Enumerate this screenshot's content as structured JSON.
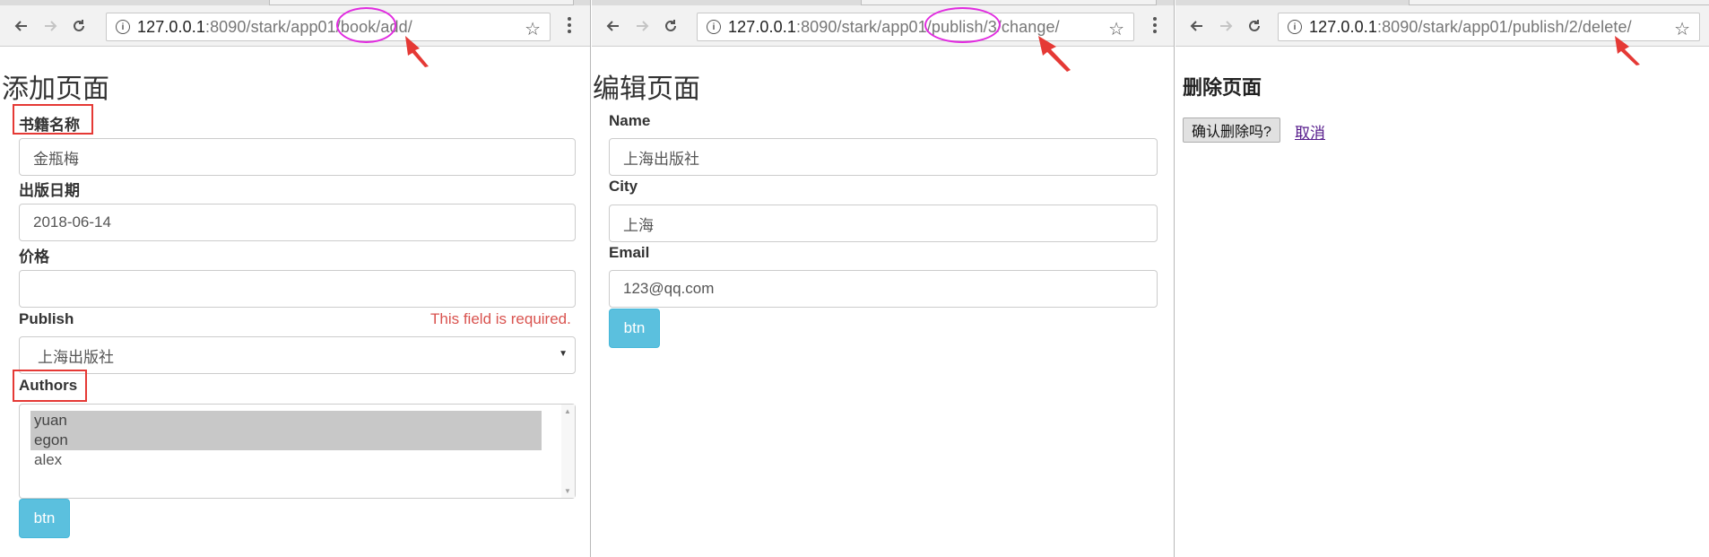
{
  "windows": {
    "add": {
      "url_prefix": "127.0.0.1",
      "url_rest": ":8090/stark/app01/book/add/",
      "page_title": "添加页面",
      "fields": {
        "book_name_label": "书籍名称",
        "book_name_value": "金瓶梅",
        "pub_date_label": "出版日期",
        "pub_date_value": "2018-06-14",
        "price_label": "价格",
        "price_value": "",
        "publish_label": "Publish",
        "publish_error": "This field is required.",
        "publish_selected": "上海出版社",
        "authors_label": "Authors",
        "authors_options": [
          "yuan",
          "egon",
          "alex"
        ]
      },
      "submit_label": "btn"
    },
    "change": {
      "url_prefix": "127.0.0.1",
      "url_rest": ":8090/stark/app01/publish/3/change/",
      "page_title": "编辑页面",
      "fields": {
        "name_label": "Name",
        "name_value": "上海出版社",
        "city_label": "City",
        "city_value": "上海",
        "email_label": "Email",
        "email_value": "123@qq.com"
      },
      "submit_label": "btn"
    },
    "delete": {
      "url_prefix": "127.0.0.1",
      "url_rest": ":8090/stark/app01/publish/2/delete/",
      "page_title": "删除页面",
      "confirm_label": "确认删除吗?",
      "cancel_label": "取消"
    }
  },
  "icons": {
    "back": "back-arrow-icon",
    "forward": "forward-arrow-icon",
    "reload": "reload-icon",
    "info": "info-icon",
    "bookmark": "star-icon",
    "menu": "vertical-dots-icon"
  },
  "colors": {
    "accent_button": "#5bc0de",
    "error": "#d9534f",
    "annotation_box": "#e53935",
    "annotation_circle": "#e12be0"
  }
}
